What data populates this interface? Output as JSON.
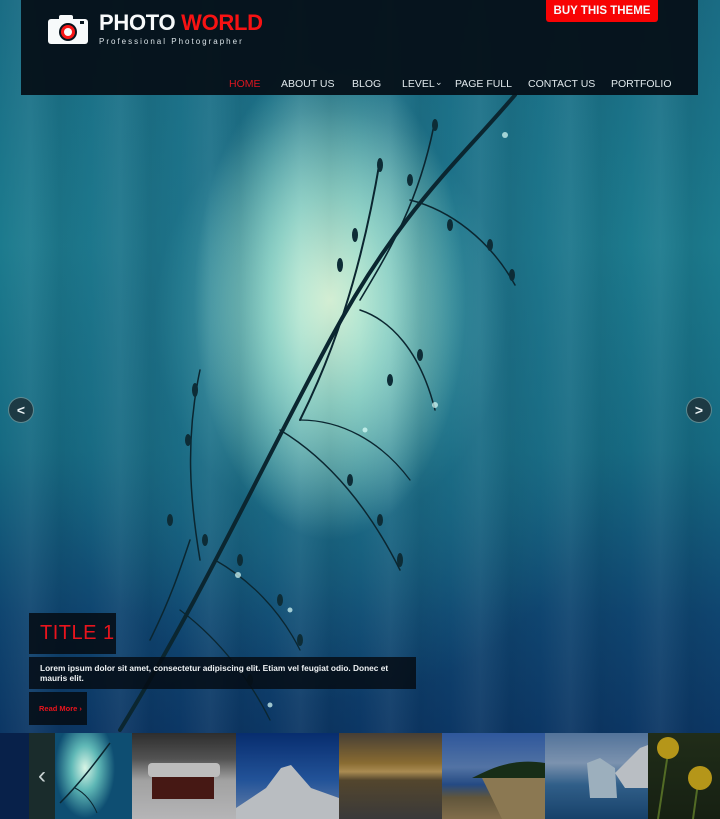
{
  "header": {
    "brand_first": "PHOTO",
    "brand_second": "WORLD",
    "tagline": "Professional Photographer",
    "buy_button": "BUY THIS THEME",
    "logo_icon": "camera-icon",
    "accent_color": "#ff0000"
  },
  "nav": {
    "items": [
      {
        "label": "HOME",
        "active": true
      },
      {
        "label": "ABOUT US",
        "active": false
      },
      {
        "label": "BLOG",
        "active": false
      },
      {
        "label": "LEVEL",
        "active": false,
        "has_dropdown": true
      },
      {
        "label": "PAGE FULL",
        "active": false
      },
      {
        "label": "CONTACT US",
        "active": false
      },
      {
        "label": "PORTFOLIO",
        "active": false
      }
    ],
    "dropdown_icon": "chevron-down-icon"
  },
  "slider": {
    "prev_icon": "chevron-left-icon",
    "next_icon": "chevron-right-icon",
    "prev_glyph": "<",
    "next_glyph": ">",
    "caption": {
      "title": "TITLE 1",
      "text": "Lorem ipsum dolor sit amet, consectetur adipiscing elit. Etiam vel feugiat odio. Donec et mauris elit.",
      "read_more": "Read More ›"
    }
  },
  "thumbnails": {
    "prev_glyph": "‹",
    "items": [
      {
        "subject": "plant-with-water-drops",
        "active": true
      },
      {
        "subject": "snowy-cabin"
      },
      {
        "subject": "snowy-mountain-peak"
      },
      {
        "subject": "sunset-lake"
      },
      {
        "subject": "tropical-beach"
      },
      {
        "subject": "iceberg"
      },
      {
        "subject": "dandelions"
      }
    ]
  }
}
